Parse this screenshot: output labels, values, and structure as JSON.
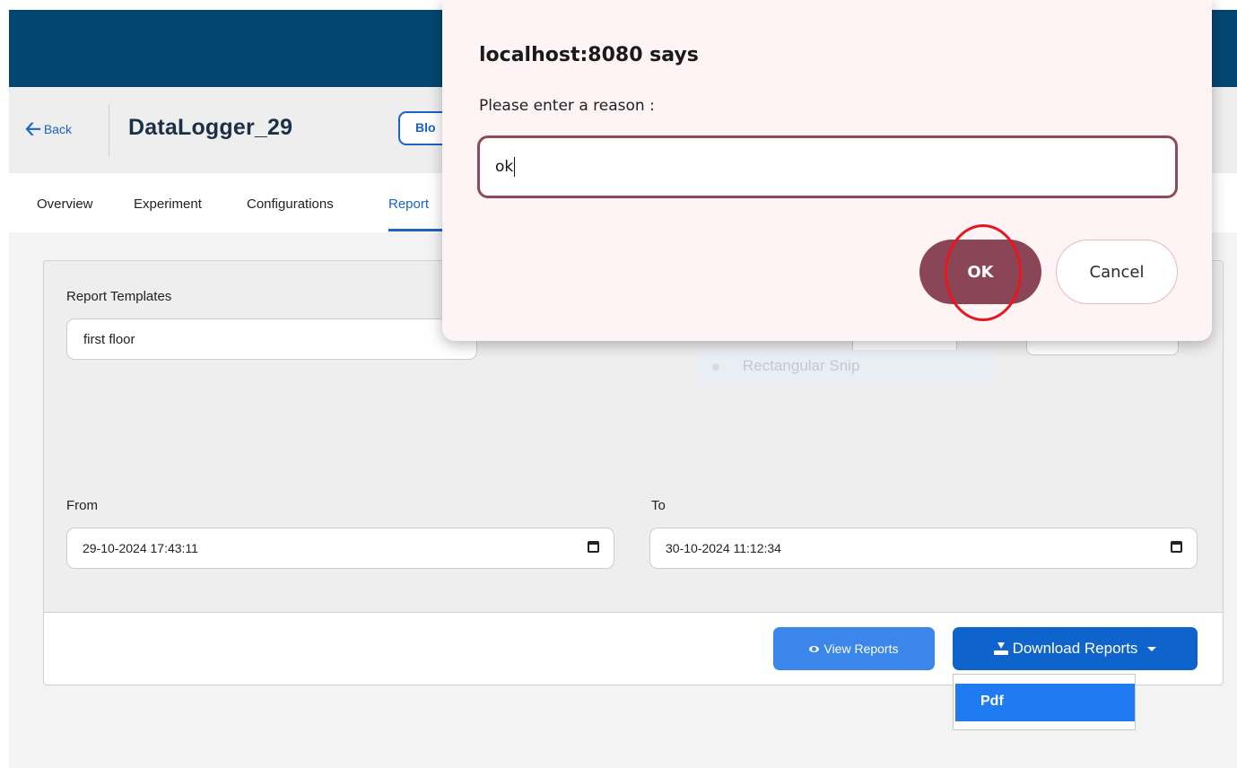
{
  "header": {
    "back_label": "Back",
    "device_title": "DataLogger_29",
    "status_badge": "Blo"
  },
  "tabs": [
    {
      "label": "Overview"
    },
    {
      "label": "Experiment"
    },
    {
      "label": "Configurations"
    },
    {
      "label": "Report"
    }
  ],
  "form": {
    "report_templates_label": "Report Templates",
    "report_template_value": "first floor",
    "from_label": "From",
    "from_value": "29-10-2024 17:43:11",
    "to_label": "To",
    "to_value": "30-10-2024 11:12:34"
  },
  "overlay": {
    "snip_label": "Rectangular Snip"
  },
  "actions": {
    "view_reports": "View Reports",
    "download_reports": "Download Reports",
    "download_options": [
      "Pdf"
    ]
  },
  "dialog": {
    "title": "localhost:8080 says",
    "message": "Please enter a reason :",
    "input_value": "ok",
    "ok_label": "OK",
    "cancel_label": "Cancel"
  },
  "colors": {
    "topbar": "#044672",
    "primary": "#1a63c8",
    "dialog_accent": "#8a4656",
    "annotation": "#e5171f"
  }
}
